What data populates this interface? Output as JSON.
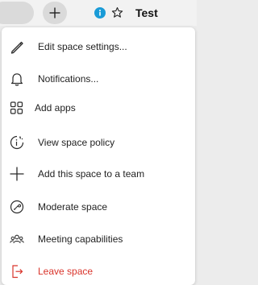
{
  "header": {
    "title": "Test",
    "plus_icon": "plus-icon",
    "info_icon": "info-icon",
    "star_icon": "star-icon",
    "info_color": "#1a9bd7"
  },
  "menu": {
    "items": [
      {
        "label": "Edit space settings...",
        "icon": "pencil-icon"
      },
      {
        "label": "Notifications...",
        "icon": "bell-icon"
      },
      {
        "label": "Add apps",
        "icon": "apps-grid-icon"
      },
      {
        "label": "View space policy",
        "icon": "policy-icon"
      },
      {
        "label": "Add this space to a team",
        "icon": "plus-icon"
      },
      {
        "label": "Moderate space",
        "icon": "moderate-icon"
      },
      {
        "label": "Meeting capabilities",
        "icon": "people-icon"
      },
      {
        "label": "Leave space",
        "icon": "leave-icon",
        "color": "#d9342b"
      }
    ]
  }
}
